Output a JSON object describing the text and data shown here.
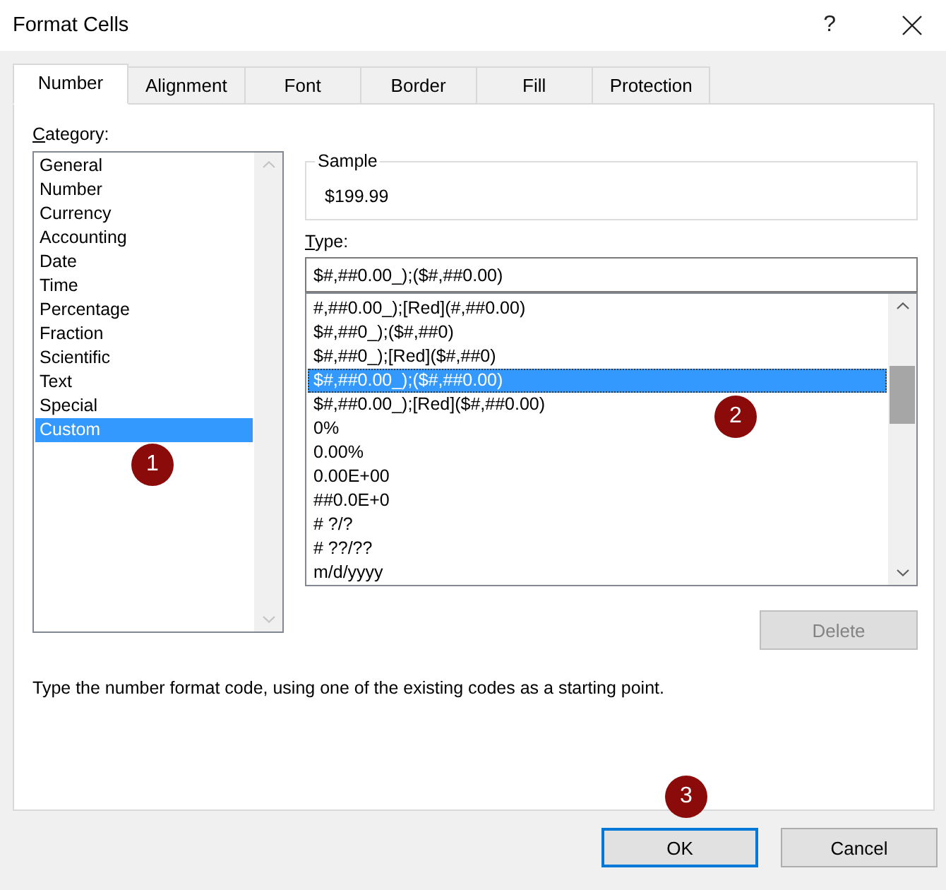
{
  "window": {
    "title": "Format Cells",
    "help_button": "?"
  },
  "tabs": [
    {
      "label": "Number",
      "selected": true
    },
    {
      "label": "Alignment",
      "selected": false
    },
    {
      "label": "Font",
      "selected": false
    },
    {
      "label": "Border",
      "selected": false
    },
    {
      "label": "Fill",
      "selected": false
    },
    {
      "label": "Protection",
      "selected": false
    }
  ],
  "category": {
    "label": "Category:",
    "scrollable": false,
    "step_marker": "1",
    "items": [
      {
        "label": "General",
        "selected": false
      },
      {
        "label": "Number",
        "selected": false
      },
      {
        "label": "Currency",
        "selected": false
      },
      {
        "label": "Accounting",
        "selected": false
      },
      {
        "label": "Date",
        "selected": false
      },
      {
        "label": "Time",
        "selected": false
      },
      {
        "label": "Percentage",
        "selected": false
      },
      {
        "label": "Fraction",
        "selected": false
      },
      {
        "label": "Scientific",
        "selected": false
      },
      {
        "label": "Text",
        "selected": false
      },
      {
        "label": "Special",
        "selected": false
      },
      {
        "label": "Custom",
        "selected": true
      }
    ]
  },
  "sample": {
    "label": "Sample",
    "value": "$199.99"
  },
  "type": {
    "label": "Type:",
    "value": "$#,##0.00_);($#,##0.00)",
    "scrollable": true,
    "step_marker": "2",
    "items": [
      {
        "label": "#,##0.00_);[Red](#,##0.00)",
        "selected": false
      },
      {
        "label": "$#,##0_);($#,##0)",
        "selected": false
      },
      {
        "label": "$#,##0_);[Red]($#,##0)",
        "selected": false
      },
      {
        "label": "$#,##0.00_);($#,##0.00)",
        "selected": true
      },
      {
        "label": "$#,##0.00_);[Red]($#,##0.00)",
        "selected": false
      },
      {
        "label": "0%",
        "selected": false
      },
      {
        "label": "0.00%",
        "selected": false
      },
      {
        "label": "0.00E+00",
        "selected": false
      },
      {
        "label": "##0.0E+0",
        "selected": false
      },
      {
        "label": "# ?/?",
        "selected": false
      },
      {
        "label": "# ??/??",
        "selected": false
      },
      {
        "label": "m/d/yyyy",
        "selected": false
      }
    ]
  },
  "delete_button": {
    "label": "Delete",
    "disabled": true
  },
  "description": "Type the number format code, using one of the existing codes as a starting point.",
  "buttons": [
    {
      "label": "OK",
      "default": true,
      "step_marker": "3"
    },
    {
      "label": "Cancel",
      "default": false
    }
  ]
}
